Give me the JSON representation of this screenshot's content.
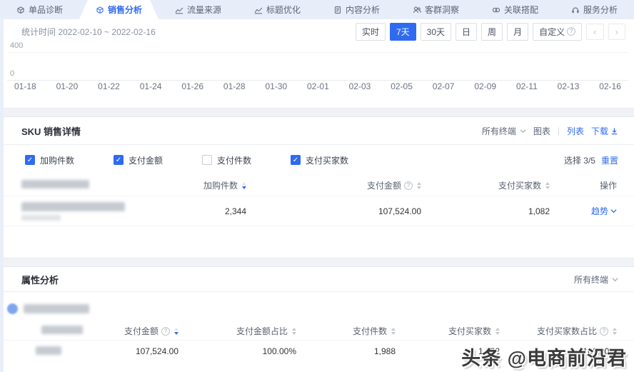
{
  "nav": {
    "tabs": [
      {
        "label": "单品诊断",
        "icon": "product-box-icon",
        "active": "false"
      },
      {
        "label": "销售分析",
        "icon": "sales-box-icon",
        "active": "true"
      },
      {
        "label": "流量来源",
        "icon": "trend-chart-icon",
        "active": "false"
      },
      {
        "label": "标题优化",
        "icon": "trend-chart-icon",
        "active": "false"
      },
      {
        "label": "内容分析",
        "icon": "document-icon",
        "active": "false"
      },
      {
        "label": "客群洞察",
        "icon": "people-icon",
        "active": "false"
      },
      {
        "label": "关联搭配",
        "icon": "link-icon",
        "active": "false"
      },
      {
        "label": "服务分析",
        "icon": "headset-icon",
        "active": "false"
      }
    ]
  },
  "toolbar": {
    "stat_time": "统计时间 2022-02-10 ~ 2022-02-16",
    "ranges": [
      {
        "label": "实时",
        "active": "false"
      },
      {
        "label": "7天",
        "active": "true"
      },
      {
        "label": "30天",
        "active": "false"
      },
      {
        "label": "日",
        "active": "false"
      },
      {
        "label": "周",
        "active": "false"
      },
      {
        "label": "月",
        "active": "false"
      },
      {
        "label": "自定义",
        "active": "false"
      }
    ],
    "prev": "‹",
    "next": "›"
  },
  "chart_data": {
    "type": "line",
    "x": [
      "01-18",
      "01-20",
      "01-22",
      "01-24",
      "01-26",
      "01-28",
      "01-30",
      "02-01",
      "02-03",
      "02-05",
      "02-07",
      "02-09",
      "02-11",
      "02-13",
      "02-16"
    ],
    "yticks": [
      "400",
      "0"
    ],
    "ylim": [
      0,
      400
    ],
    "series": [],
    "note": "plot area appears blank (no visible series drawn)"
  },
  "sku": {
    "title": "SKU 销售详情",
    "terminal": "所有终端",
    "view_chart": "图表",
    "divider": "|",
    "view_list": "列表",
    "download": "下载",
    "metrics": [
      {
        "label": "加购件数",
        "checked": "true"
      },
      {
        "label": "支付金额",
        "checked": "true"
      },
      {
        "label": "支付件数",
        "checked": "false"
      },
      {
        "label": "支付买家数",
        "checked": "true"
      }
    ],
    "selection": "选择 3/5",
    "reset": "重置",
    "headers": {
      "col2": "加购件数",
      "col3": "支付金额",
      "col4": "支付买家数",
      "col5": "操作"
    },
    "row": {
      "add_cart": "2,344",
      "pay_amount": "107,524.00",
      "pay_buyers": "1,082",
      "action": "趋势"
    }
  },
  "attr": {
    "title": "属性分析",
    "terminal": "所有终端",
    "headers": {
      "col2": "支付金额",
      "col3": "支付金额占比",
      "col4": "支付件数",
      "col5": "支付买家数",
      "col6": "支付买家数占比"
    },
    "row": {
      "pay_amount": "107,524.00",
      "pay_amount_ratio": "100.00%",
      "pay_items": "1,988",
      "pay_buyers": "1,082",
      "pay_buyers_ratio": "100.00%"
    }
  },
  "watermark": "头条 @电商前沿君"
}
